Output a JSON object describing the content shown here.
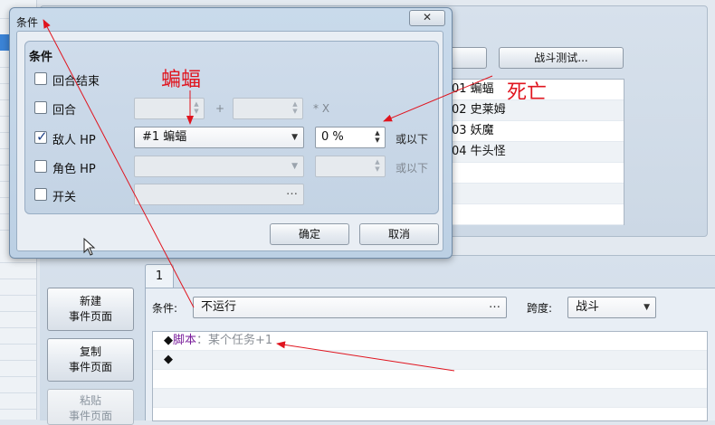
{
  "dialog": {
    "title": "条件",
    "close_label": "✕",
    "group_title": "条件",
    "rows": [
      {
        "label": "回合结束",
        "checked": false
      },
      {
        "label": "回合",
        "checked": false,
        "plus": "+",
        "times": "* X"
      },
      {
        "label": "敌人 HP",
        "checked": true,
        "target": "#1 蝙蝠",
        "value": "0 %",
        "suffix": "或以下"
      },
      {
        "label": "角色 HP",
        "checked": false,
        "suffix": "或以下"
      },
      {
        "label": "开关",
        "checked": false,
        "ellipsis": "…"
      }
    ],
    "ok_label": "确定",
    "cancel_label": "取消"
  },
  "background": {
    "battle_test_label": "战斗测试...",
    "enemy_list": [
      "01 蝙蝠",
      "02 史莱姆",
      "03 妖魔",
      "04 牛头怪"
    ],
    "tab_label": "1",
    "side_buttons": [
      {
        "line1": "新建",
        "line2": "事件页面"
      },
      {
        "line1": "复制",
        "line2": "事件页面"
      },
      {
        "line1": "粘贴",
        "line2": "事件页面"
      }
    ],
    "condition_label": "条件:",
    "condition_value": "不运行",
    "condition_ellipsis": "…",
    "span_label": "跨度:",
    "span_value": "战斗",
    "script_rows": [
      {
        "bullet": "◆",
        "keyword": "脚本",
        "sep": "：",
        "text": "某个任务+1"
      },
      {
        "bullet": "◆",
        "keyword": "",
        "sep": "",
        "text": ""
      }
    ]
  },
  "annotations": {
    "bat_note": "蝙蝠",
    "death_note": "死亡",
    "color": "#e0141e"
  }
}
